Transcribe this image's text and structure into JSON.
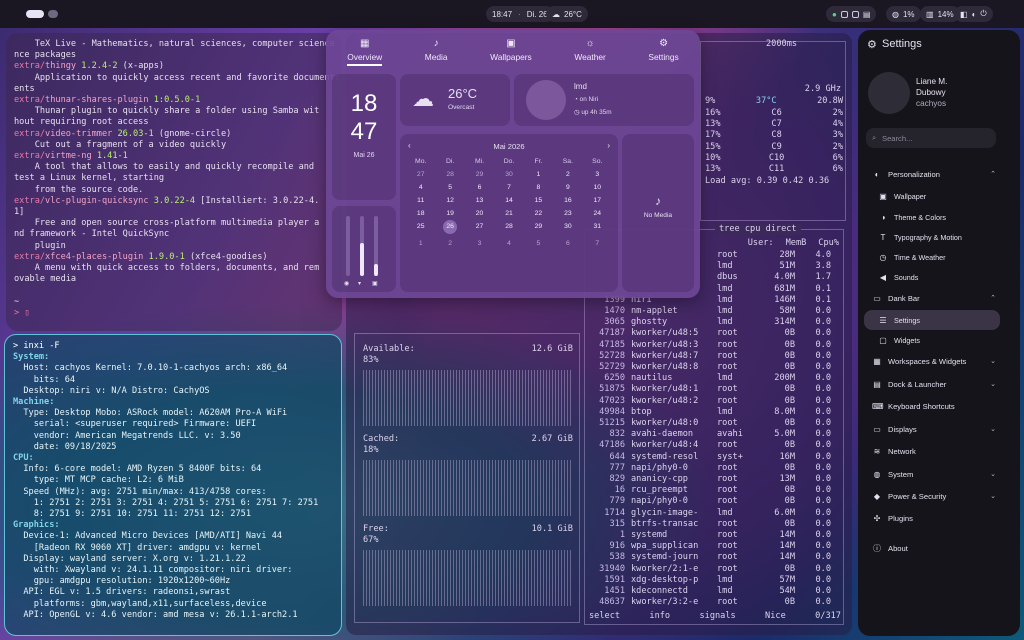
{
  "topbar": {
    "time": "18:47",
    "date": "Di. 26",
    "temp": "26°C",
    "volume": "1%",
    "battery": "14%"
  },
  "term1": {
    "lines": [
      {
        "t": "    TeX Live - Mathematics, natural sciences, computer science",
        "c": "txt"
      },
      {
        "t": "nce packages",
        "c": "txt"
      },
      {
        "t": "extra/thingy 1.2.4-2 (x-apps)",
        "c": "pkgline",
        "repo": "extra/",
        "pkg": "thingy",
        "ver": "1.2.4-2",
        "rest": " (x-apps)"
      },
      {
        "t": "    Application to quickly access recent and favorite documents",
        "c": "txt"
      },
      {
        "t": "ents",
        "c": "txt"
      },
      {
        "t": "extra/thunar-shares-plugin 1:0.5.0-1",
        "c": "pkgline",
        "repo": "extra/",
        "pkg": "thunar-shares-plugin",
        "ver": "1:0.5.0-1",
        "rest": ""
      },
      {
        "t": "    Thunar plugin to quickly share a folder using Samba wit",
        "c": "txt"
      },
      {
        "t": "hout requiring root access",
        "c": "txt"
      },
      {
        "t": "extra/video-trimmer 26.03-1 (gnome-circle)",
        "c": "pkgline",
        "repo": "extra/",
        "pkg": "video-trimmer",
        "ver": "26.03-1",
        "rest": " (gnome-circle)"
      },
      {
        "t": "    Cut out a fragment of a video quickly",
        "c": "txt"
      },
      {
        "t": "extra/virtme-ng 1.41-1",
        "c": "pkgline",
        "repo": "extra/",
        "pkg": "virtme-ng",
        "ver": "1.41-1",
        "rest": ""
      },
      {
        "t": "    A tool that allows to easily and quickly recompile and",
        "c": "txt"
      },
      {
        "t": "test a Linux kernel, starting",
        "c": "txt"
      },
      {
        "t": "    from the source code.",
        "c": "txt"
      },
      {
        "t": "extra/vlc-plugin-quicksync 3.0.22-4 [Installiert: 3.0.22-4.",
        "c": "pkgline",
        "repo": "extra/",
        "pkg": "vlc-plugin-quicksync",
        "ver": "3.0.22-4",
        "rest": " [Installiert: 3.0.22-4."
      },
      {
        "t": "1]",
        "c": "txt"
      },
      {
        "t": "    Free and open source cross-platform multimedia player a",
        "c": "txt"
      },
      {
        "t": "nd framework - Intel QuickSync",
        "c": "txt"
      },
      {
        "t": "    plugin",
        "c": "txt"
      },
      {
        "t": "extra/xfce4-places-plugin 1.9.0-1 (xfce4-goodies)",
        "c": "pkgline",
        "repo": "extra/",
        "pkg": "xfce4-places-plugin",
        "ver": "1.9.0-1",
        "rest": " (xfce4-goodies)"
      },
      {
        "t": "    A menu with quick access to folders, documents, and rem",
        "c": "txt"
      },
      {
        "t": "ovable media",
        "c": "txt"
      },
      {
        "t": "",
        "c": "txt"
      },
      {
        "t": "~",
        "c": "txt"
      },
      {
        "t": "> ▯",
        "c": "prompt"
      }
    ]
  },
  "term2": {
    "lines": [
      "> inxi -F",
      "System:",
      "  Host: cachyos Kernel: 7.0.10-1-cachyos arch: x86_64",
      "    bits: 64",
      "  Desktop: niri v: N/A Distro: CachyOS",
      "Machine:",
      "  Type: Desktop Mobo: ASRock model: A620AM Pro-A WiFi",
      "    serial: <superuser required> Firmware: UEFI",
      "    vendor: American Megatrends LLC. v: 3.50",
      "    date: 09/18/2025",
      "CPU:",
      "  Info: 6-core model: AMD Ryzen 5 8400F bits: 64",
      "    type: MT MCP cache: L2: 6 MiB",
      "  Speed (MHz): avg: 2751 min/max: 413/4758 cores:",
      "    1: 2751 2: 2751 3: 2751 4: 2751 5: 2751 6: 2751 7: 2751",
      "    8: 2751 9: 2751 10: 2751 11: 2751 12: 2751",
      "Graphics:",
      "  Device-1: Advanced Micro Devices [AMD/ATI] Navi 44",
      "    [Radeon RX 9060 XT] driver: amdgpu v: kernel",
      "  Display: wayland server: X.org v: 1.21.1.22",
      "    with: Xwayland v: 24.1.11 compositor: niri driver:",
      "    gpu: amdgpu resolution: 1920x1200~60Hz",
      "  API: EGL v: 1.5 drivers: radeonsi,swrast",
      "    platforms: gbm,wayland,x11,surfaceless,device",
      "  API: OpenGL v: 4.6 vendor: amd mesa v: 26.1.1-arch2.1"
    ]
  },
  "btop": {
    "refresh": "2000ms",
    "cpu_freq": "2.9 GHz",
    "cpu_total": {
      "pct": "9%",
      "temp": "37°C",
      "watt": "20.8W"
    },
    "cores": [
      {
        "a": "16%",
        "n": "C6",
        "b": "2%"
      },
      {
        "a": "13%",
        "n": "C7",
        "b": "4%"
      },
      {
        "a": "17%",
        "n": "C8",
        "b": "3%"
      },
      {
        "a": "15%",
        "n": "C9",
        "b": "2%"
      },
      {
        "a": "10%",
        "n": "C10",
        "b": "6%"
      },
      {
        "a": "13%",
        "n": "C11",
        "b": "6%"
      }
    ],
    "load_avg": "Load avg: 0.39 0.42 0.36",
    "proc_title": "tree  cpu direct",
    "proc_headers": [
      "User:",
      "MemB",
      "Cpu%"
    ],
    "processes": [
      {
        "pid": "",
        "name": "",
        "user": "root",
        "mem": "28M",
        "cpu": "4.0"
      },
      {
        "pid": "",
        "name": "",
        "user": "lmd",
        "mem": "51M",
        "cpu": "3.8"
      },
      {
        "pid": "",
        "name": "",
        "user": "dbus",
        "mem": "4.0M",
        "cpu": "1.7"
      },
      {
        "pid": "",
        "name": "",
        "user": "lmd",
        "mem": "681M",
        "cpu": "0.1"
      },
      {
        "pid": "1399",
        "name": "niri",
        "user": "lmd",
        "mem": "146M",
        "cpu": "0.1"
      },
      {
        "pid": "1470",
        "name": "nm-applet",
        "user": "lmd",
        "mem": "58M",
        "cpu": "0.0"
      },
      {
        "pid": "3065",
        "name": "ghostty",
        "user": "lmd",
        "mem": "314M",
        "cpu": "0.0"
      },
      {
        "pid": "47187",
        "name": "kworker/u48:5",
        "user": "root",
        "mem": "0B",
        "cpu": "0.0"
      },
      {
        "pid": "47185",
        "name": "kworker/u48:3",
        "user": "root",
        "mem": "0B",
        "cpu": "0.0"
      },
      {
        "pid": "52728",
        "name": "kworker/u48:7",
        "user": "root",
        "mem": "0B",
        "cpu": "0.0"
      },
      {
        "pid": "52729",
        "name": "kworker/u48:8",
        "user": "root",
        "mem": "0B",
        "cpu": "0.0"
      },
      {
        "pid": "6250",
        "name": "nautilus",
        "user": "lmd",
        "mem": "200M",
        "cpu": "0.0"
      },
      {
        "pid": "51875",
        "name": "kworker/u48:1",
        "user": "root",
        "mem": "0B",
        "cpu": "0.0"
      },
      {
        "pid": "47023",
        "name": "kworker/u48:2",
        "user": "root",
        "mem": "0B",
        "cpu": "0.0"
      },
      {
        "pid": "49984",
        "name": "btop",
        "user": "lmd",
        "mem": "8.0M",
        "cpu": "0.0"
      },
      {
        "pid": "51215",
        "name": "kworker/u48:0",
        "user": "root",
        "mem": "0B",
        "cpu": "0.0"
      },
      {
        "pid": "832",
        "name": "avahi-daemon",
        "user": "avahi",
        "mem": "5.0M",
        "cpu": "0.0"
      },
      {
        "pid": "47186",
        "name": "kworker/u48:4",
        "user": "root",
        "mem": "0B",
        "cpu": "0.0"
      },
      {
        "pid": "644",
        "name": "systemd-resol",
        "user": "syst+",
        "mem": "16M",
        "cpu": "0.0"
      },
      {
        "pid": "777",
        "name": "napi/phy0-0",
        "user": "root",
        "mem": "0B",
        "cpu": "0.0"
      },
      {
        "pid": "829",
        "name": "ananicy-cpp",
        "user": "root",
        "mem": "13M",
        "cpu": "0.0"
      },
      {
        "pid": "16",
        "name": "rcu_preempt",
        "user": "root",
        "mem": "0B",
        "cpu": "0.0"
      },
      {
        "pid": "779",
        "name": "napi/phy0-0",
        "user": "root",
        "mem": "0B",
        "cpu": "0.0"
      },
      {
        "pid": "1714",
        "name": "glycin-image-",
        "user": "lmd",
        "mem": "6.0M",
        "cpu": "0.0"
      },
      {
        "pid": "315",
        "name": "btrfs-transac",
        "user": "root",
        "mem": "0B",
        "cpu": "0.0"
      },
      {
        "pid": "1",
        "name": "systemd",
        "user": "root",
        "mem": "14M",
        "cpu": "0.0"
      },
      {
        "pid": "916",
        "name": "wpa_supplican",
        "user": "root",
        "mem": "14M",
        "cpu": "0.0"
      },
      {
        "pid": "538",
        "name": "systemd-journ",
        "user": "root",
        "mem": "14M",
        "cpu": "0.0"
      },
      {
        "pid": "31940",
        "name": "kworker/2:1-e",
        "user": "root",
        "mem": "0B",
        "cpu": "0.0"
      },
      {
        "pid": "1591",
        "name": "xdg-desktop-p",
        "user": "lmd",
        "mem": "57M",
        "cpu": "0.0"
      },
      {
        "pid": "1451",
        "name": "kdeconnectd",
        "user": "lmd",
        "mem": "54M",
        "cpu": "0.0"
      },
      {
        "pid": "48637",
        "name": "kworker/3:2-e",
        "user": "root",
        "mem": "0B",
        "cpu": "0.0"
      }
    ],
    "proc_footer": {
      "select": "select",
      "info": "info",
      "signals": "signals",
      "nice": "Nice",
      "count": "0/317"
    },
    "mem": [
      {
        "label": "Available:",
        "value": "12.6 GiB",
        "pct": "83%"
      },
      {
        "label": "Cached:",
        "value": "2.67 GiB",
        "pct": "18%"
      },
      {
        "label": "Free:",
        "value": "10.1 GiB",
        "pct": "67%"
      }
    ]
  },
  "overlay": {
    "tabs": [
      {
        "label": "Overview",
        "icon": "grid-icon",
        "glyph": "▦"
      },
      {
        "label": "Media",
        "icon": "music-icon",
        "glyph": "♪"
      },
      {
        "label": "Wallpapers",
        "icon": "image-icon",
        "glyph": "▣"
      },
      {
        "label": "Weather",
        "icon": "sun-icon",
        "glyph": "☼"
      },
      {
        "label": "Settings",
        "icon": "gear-icon",
        "glyph": "⚙"
      }
    ],
    "clock": {
      "hours": "18",
      "minutes": "47",
      "date": "Mai 26"
    },
    "weather": {
      "temp": "26°C",
      "condition": "Overcast"
    },
    "user": {
      "name": "lmd",
      "host": "on Niri",
      "uptime": "up 4h 35m"
    },
    "calendar": {
      "title": "Mai 2026",
      "weekdays": [
        "Mo.",
        "Di.",
        "Mi.",
        "Do.",
        "Fr.",
        "Sa.",
        "So."
      ],
      "weeks": [
        [
          [
            "27",
            1
          ],
          [
            "28",
            1
          ],
          [
            "29",
            1
          ],
          [
            "30",
            1
          ],
          [
            "1",
            0
          ],
          [
            "2",
            0
          ],
          [
            "3",
            0
          ]
        ],
        [
          [
            "4",
            0
          ],
          [
            "5",
            0
          ],
          [
            "6",
            0
          ],
          [
            "7",
            0
          ],
          [
            "8",
            0
          ],
          [
            "9",
            0
          ],
          [
            "10",
            0
          ]
        ],
        [
          [
            "11",
            0
          ],
          [
            "12",
            0
          ],
          [
            "13",
            0
          ],
          [
            "14",
            0
          ],
          [
            "15",
            0
          ],
          [
            "16",
            0
          ],
          [
            "17",
            0
          ]
        ],
        [
          [
            "18",
            0
          ],
          [
            "19",
            0
          ],
          [
            "20",
            0
          ],
          [
            "21",
            0
          ],
          [
            "22",
            0
          ],
          [
            "23",
            0
          ],
          [
            "24",
            0
          ]
        ],
        [
          [
            "25",
            0
          ],
          [
            "26",
            2
          ],
          [
            "27",
            0
          ],
          [
            "28",
            0
          ],
          [
            "29",
            0
          ],
          [
            "30",
            0
          ],
          [
            "31",
            0
          ]
        ],
        [
          [
            "1",
            1
          ],
          [
            "2",
            1
          ],
          [
            "3",
            1
          ],
          [
            "4",
            1
          ],
          [
            "5",
            1
          ],
          [
            "6",
            1
          ],
          [
            "7",
            1
          ]
        ]
      ]
    },
    "media": {
      "label": "No Media"
    },
    "sliders": [
      0.0,
      0.55,
      0.2
    ]
  },
  "settings": {
    "title": "Settings",
    "user": {
      "name": "Liane M.",
      "name2": "Dubowy",
      "handle": "cachyos"
    },
    "search_placeholder": "Search...",
    "nav": [
      {
        "label": "Personalization",
        "icon": "palette-icon",
        "glyph": "◐",
        "sub": false,
        "chev": "^",
        "sel": false
      },
      {
        "label": "Wallpaper",
        "icon": "wallpaper-icon",
        "glyph": "▣",
        "sub": true,
        "chev": "",
        "sel": false
      },
      {
        "label": "Theme & Colors",
        "icon": "theme-icon",
        "glyph": "◑",
        "sub": true,
        "chev": "",
        "sel": false
      },
      {
        "label": "Typography & Motion",
        "icon": "typography-icon",
        "glyph": "T",
        "sub": true,
        "chev": "",
        "sel": false
      },
      {
        "label": "Time & Weather",
        "icon": "clock-icon",
        "glyph": "◷",
        "sub": true,
        "chev": "",
        "sel": false
      },
      {
        "label": "Sounds",
        "icon": "speaker-icon",
        "glyph": "◀",
        "sub": true,
        "chev": "",
        "sel": false
      },
      {
        "label": "Dank Bar",
        "icon": "bar-icon",
        "glyph": "▭",
        "sub": false,
        "chev": "^",
        "sel": false
      },
      {
        "label": "Settings",
        "icon": "sliders-icon",
        "glyph": "☰",
        "sub": true,
        "chev": "",
        "sel": true
      },
      {
        "label": "Widgets",
        "icon": "widgets-icon",
        "glyph": "▢",
        "sub": true,
        "chev": "",
        "sel": false
      },
      {
        "label": "Workspaces & Widgets",
        "icon": "workspaces-icon",
        "glyph": "▦",
        "sub": false,
        "chev": "v",
        "sel": false
      },
      {
        "label": "Dock & Launcher",
        "icon": "dock-icon",
        "glyph": "▤",
        "sub": false,
        "chev": "v",
        "sel": false
      },
      {
        "label": "Keyboard Shortcuts",
        "icon": "keyboard-icon",
        "glyph": "⌨",
        "sub": false,
        "chev": "",
        "sel": false
      },
      {
        "label": "Displays",
        "icon": "monitor-icon",
        "glyph": "▭",
        "sub": false,
        "chev": "v",
        "sel": false
      },
      {
        "label": "Network",
        "icon": "wifi-icon",
        "glyph": "≋",
        "sub": false,
        "chev": "",
        "sel": false
      },
      {
        "label": "System",
        "icon": "globe-icon",
        "glyph": "◍",
        "sub": false,
        "chev": "v",
        "sel": false
      },
      {
        "label": "Power & Security",
        "icon": "shield-icon",
        "glyph": "◆",
        "sub": false,
        "chev": "v",
        "sel": false
      },
      {
        "label": "Plugins",
        "icon": "puzzle-icon",
        "glyph": "✣",
        "sub": false,
        "chev": "",
        "sel": false
      },
      {
        "label": "About",
        "icon": "info-icon",
        "glyph": "ⓘ",
        "sub": false,
        "chev": "",
        "sel": false
      }
    ]
  }
}
